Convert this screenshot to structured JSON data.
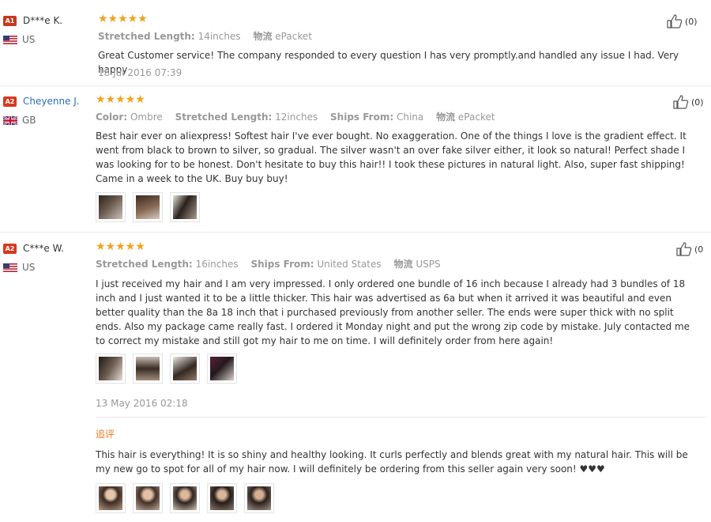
{
  "reviews": [
    {
      "badge": "A1",
      "name": "D***e K.",
      "country": "US",
      "stars": "★★★★★",
      "attrs": [
        {
          "key": "Stretched Length:",
          "val": "14inches"
        },
        {
          "key": "物流",
          "val": "ePacket"
        }
      ],
      "likes": "(0)",
      "text": "Great Customer service! The company responded to every question I has very promptly.and handled any issue I had. Very happy",
      "date": "18 Jul 2016 07:39"
    },
    {
      "badge": "A2",
      "name": "Cheyenne J.",
      "country": "GB",
      "stars": "★★★★★",
      "attrs": [
        {
          "key": "Color:",
          "val": "Ombre"
        },
        {
          "key": "Stretched Length:",
          "val": "12inches"
        },
        {
          "key": "Ships From:",
          "val": "China"
        },
        {
          "key": "物流",
          "val": "ePacket"
        }
      ],
      "likes": "(0)",
      "text": "Best hair ever on aliexpress! Softest hair I've ever bought. No exaggeration. One of the things I love is the gradient effect. It went from black to brown to silver, so gradual. The silver wasn't an over fake silver either, it look so natural! Perfect shade I was looking for to be honest. Don't hesitate to buy this hair!! I took these pictures in natural light. Also, super fast shipping! Came in a week to the UK. Buy buy buy!"
    },
    {
      "badge": "A2",
      "name": "C***e W.",
      "country": "US",
      "stars": "★★★★★",
      "attrs": [
        {
          "key": "Stretched Length:",
          "val": "16inches"
        },
        {
          "key": "Ships From:",
          "val": "United States"
        },
        {
          "key": "物流",
          "val": "USPS"
        }
      ],
      "likes": "(0",
      "text": "I just received my hair and I am very impressed. I only ordered one bundle of 16 inch because I already had 3 bundles of 18 inch and I just wanted it to be a little thicker. This hair was advertised as 6a but when it arrived it was beautiful and even better quality than the 8a 18 inch that i purchased previously from another seller. The ends were super thick with no split ends. Also my package came really fast. I ordered it Monday night and put the wrong zip code by mistake. July contacted me to correct my mistake and still got my hair to me on time. I will definitely order from here again!",
      "date": "13 May 2016 02:18",
      "followup_label": "追评",
      "followup_text": "This hair is everything! It is so shiny and healthy looking. It curls perfectly and blends great with my natural hair. This will be my new go to spot for all of my hair now. I will definitely be ordering from this seller again very soon! ♥♥♥"
    }
  ],
  "colors": {
    "star": "#f3a21a",
    "badge": "#d9371f",
    "link": "#2a6ebb",
    "followup": "#f07b1f"
  }
}
